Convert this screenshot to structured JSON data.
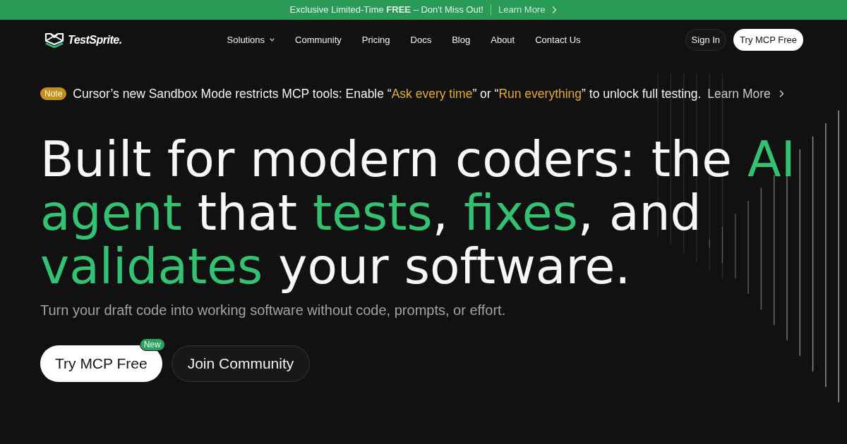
{
  "promo_banner": {
    "text": "Exclusive Limited-Time **FREE** – Don't Miss Out!",
    "link": "Learn More"
  },
  "nav": {
    "logo": "TestSprite.",
    "items": [
      {
        "label": "Solutions",
        "has_menu": true
      },
      {
        "label": "Community",
        "has_menu": false
      },
      {
        "label": "Pricing",
        "has_menu": false
      },
      {
        "label": "Docs",
        "has_menu": false
      },
      {
        "label": "Blog",
        "has_menu": false
      },
      {
        "label": "About",
        "has_menu": false
      },
      {
        "label": "Contact Us",
        "has_menu": false
      }
    ],
    "sign_in": "Sign In",
    "cta": "Try MCP Free"
  },
  "notice": {
    "badge": "Note",
    "segments": [
      {
        "text": "Cursor’s new Sandbox Mode restricts MCP tools: Enable “",
        "accent": false
      },
      {
        "text": "Ask every time",
        "accent": true
      },
      {
        "text": "” or “",
        "accent": false
      },
      {
        "text": "Run everything",
        "accent": true
      },
      {
        "text": "” to unlock full testing.",
        "accent": false
      }
    ],
    "link": "Learn More"
  },
  "hero": {
    "headline": {
      "lines": [
        [
          {
            "text": "Built for modern coders: the ",
            "accent": false
          },
          {
            "text": "AI",
            "accent": true
          }
        ],
        [
          {
            "text": "agent",
            "accent": true
          },
          {
            "text": " that ",
            "accent": false
          },
          {
            "text": "tests",
            "accent": true
          },
          {
            "text": ", ",
            "accent": false
          },
          {
            "text": "fixes",
            "accent": true
          },
          {
            "text": ", and",
            "accent": false
          }
        ],
        [
          {
            "text": "validates",
            "accent": true
          },
          {
            "text": " your software.",
            "accent": false
          }
        ]
      ]
    },
    "subtitle": "Turn your draft code into working software without code, prompts, or effort.",
    "buttons": [
      {
        "label": "Try MCP Free",
        "kind": "primary",
        "badge": "New"
      },
      {
        "label": "Join Community",
        "kind": "secondary"
      }
    ]
  }
}
